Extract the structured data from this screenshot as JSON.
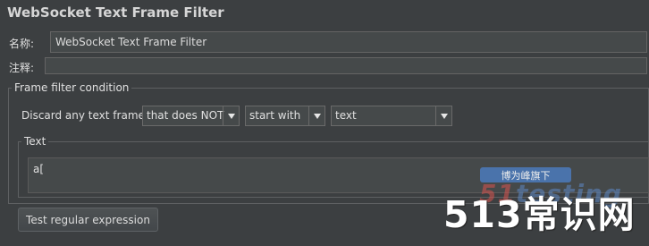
{
  "panel": {
    "title": "WebSocket Text Frame Filter"
  },
  "form": {
    "name_label": "名称:",
    "name_value": "WebSocket Text Frame Filter",
    "comment_label": "注释:",
    "comment_value": ""
  },
  "frame_filter": {
    "group_title": "Frame filter condition",
    "discard_label": "Discard any text frame",
    "condition": "that does NOT",
    "match_type": "start with",
    "frame_type": "text",
    "text_group_title": "Text",
    "text_value": "a[",
    "test_button": "Test regular expression"
  },
  "watermark": {
    "badge": "博为峰旗下",
    "logo_a": "51",
    "logo_b": "testing",
    "big": "513常识网"
  }
}
